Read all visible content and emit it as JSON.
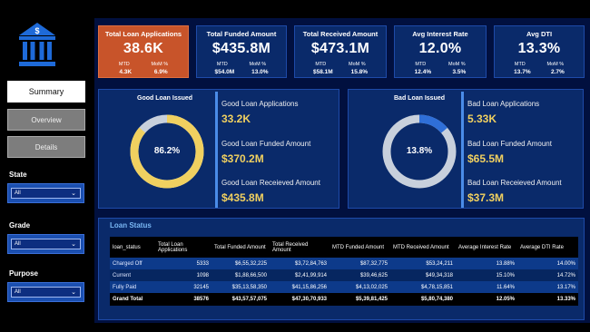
{
  "colors": {
    "accent": "#c8542a",
    "panel": "#0a2a6a",
    "background": "#01103f",
    "highlight_value": "#f0d060",
    "donut_good": "#f0d060",
    "donut_bad": "#c8d0dc"
  },
  "nav": {
    "summary": "Summary",
    "overview": "Overview",
    "details": "Details"
  },
  "filters": [
    {
      "label": "State",
      "value": "All"
    },
    {
      "label": "Grade",
      "value": "All"
    },
    {
      "label": "Purpose",
      "value": "All"
    }
  ],
  "kpis": [
    {
      "title": "Total Loan Applications",
      "value": "38.6K",
      "mtd_label": "MTD",
      "mom_label": "MoM %",
      "mtd": "4.3K",
      "mom": "6.9%"
    },
    {
      "title": "Total Funded Amount",
      "value": "$435.8M",
      "mtd_label": "MTD",
      "mom_label": "MoM %",
      "mtd": "$54.0M",
      "mom": "13.0%"
    },
    {
      "title": "Total Received Amount",
      "value": "$473.1M",
      "mtd_label": "MTD",
      "mom_label": "MoM %",
      "mtd": "$58.1M",
      "mom": "15.8%"
    },
    {
      "title": "Avg Interest Rate",
      "value": "12.0%",
      "mtd_label": "MTD",
      "mom_label": "MoM %",
      "mtd": "12.4%",
      "mom": "3.5%"
    },
    {
      "title": "Avg DTI",
      "value": "13.3%",
      "mtd_label": "MTD",
      "mom_label": "MoM %",
      "mtd": "13.7%",
      "mom": "2.7%"
    }
  ],
  "good_loan": {
    "title": "Good Loan Issued",
    "percent": "86.2%",
    "percent_value": 86.2,
    "applications_label": "Good Loan Applications",
    "applications": "33.2K",
    "funded_label": "Good Loan Funded Amount",
    "funded": "$370.2M",
    "received_label": "Good Loan Receieved Amount",
    "received": "$435.8M"
  },
  "bad_loan": {
    "title": "Bad Loan Issued",
    "percent": "13.8%",
    "percent_value": 13.8,
    "applications_label": "Bad Loan Applications",
    "applications": "5.33K",
    "funded_label": "Bad Loan Funded Amount",
    "funded": "$65.5M",
    "received_label": "Bad Loan Receieved Amount",
    "received": "$37.3M"
  },
  "loan_status": {
    "title": "Loan Status",
    "headers": [
      "loan_status",
      "Total Loan Applications",
      "Total Funded Amount",
      "Total Received Amount",
      "MTD Funded Amount",
      "MTD Received Amount",
      "Average Interest Rate",
      "Average DTI Rate"
    ],
    "rows": [
      [
        "Charged Off",
        "5333",
        "$6,55,32,225",
        "$3,72,84,763",
        "$87,32,775",
        "$53,24,211",
        "13.88%",
        "14.00%"
      ],
      [
        "Current",
        "1098",
        "$1,88,66,500",
        "$2,41,99,914",
        "$39,46,625",
        "$49,34,318",
        "15.10%",
        "14.72%"
      ],
      [
        "Fully Paid",
        "32145",
        "$35,13,58,350",
        "$41,15,86,256",
        "$4,13,02,025",
        "$4,78,15,851",
        "11.64%",
        "13.17%"
      ]
    ],
    "total": [
      "Grand Total",
      "38576",
      "$43,57,57,075",
      "$47,30,70,933",
      "$5,39,81,425",
      "$5,80,74,380",
      "12.05%",
      "13.33%"
    ]
  }
}
